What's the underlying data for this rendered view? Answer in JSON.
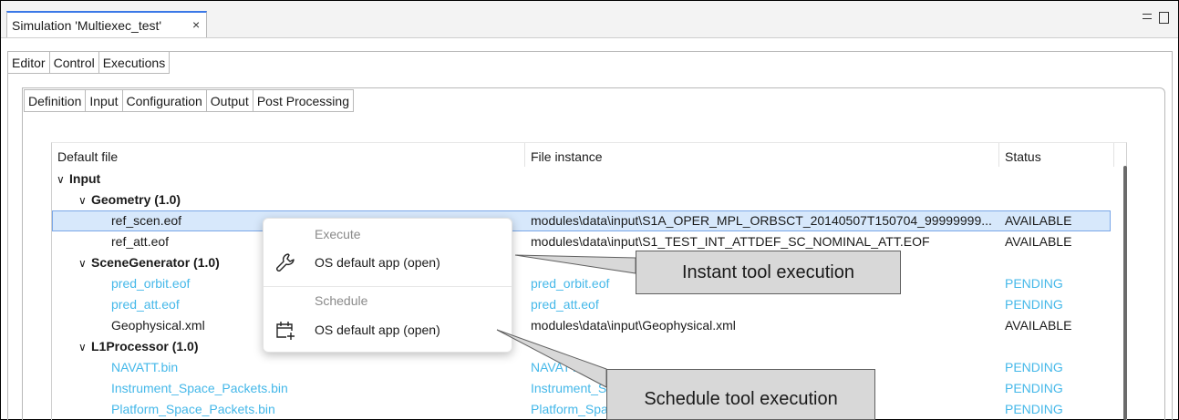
{
  "editor": {
    "tab_title": "Simulation 'Multiexec_test'",
    "close_symbol": "×"
  },
  "top_tabs": [
    "Editor",
    "Control",
    "Executions"
  ],
  "sub_tabs": [
    "Definition",
    "Input",
    "Configuration",
    "Output",
    "Post Processing"
  ],
  "table": {
    "headers": {
      "default_file": "Default file",
      "file_instance": "File instance",
      "status": "Status"
    },
    "rows": [
      {
        "name": "Input",
        "instance": "",
        "status": "",
        "pending": false
      },
      {
        "name": "Geometry (1.0)",
        "instance": "",
        "status": "",
        "pending": false
      },
      {
        "name": "ref_scen.eof",
        "instance": "modules\\data\\input\\S1A_OPER_MPL_ORBSCT_20140507T150704_99999999...",
        "status": "AVAILABLE",
        "pending": false
      },
      {
        "name": "ref_att.eof",
        "instance": "modules\\data\\input\\S1_TEST_INT_ATTDEF_SC_NOMINAL_ATT.EOF",
        "status": "AVAILABLE",
        "pending": false
      },
      {
        "name": "SceneGenerator (1.0)",
        "instance": "",
        "status": "",
        "pending": false
      },
      {
        "name": "pred_orbit.eof",
        "instance": "pred_orbit.eof",
        "status": "PENDING",
        "pending": true
      },
      {
        "name": "pred_att.eof",
        "instance": "pred_att.eof",
        "status": "PENDING",
        "pending": true
      },
      {
        "name": "Geophysical.xml",
        "instance": "modules\\data\\input\\Geophysical.xml",
        "status": "AVAILABLE",
        "pending": false
      },
      {
        "name": "L1Processor (1.0)",
        "instance": "",
        "status": "",
        "pending": false
      },
      {
        "name": "NAVATT.bin",
        "instance": "NAVATT.bin",
        "status": "PENDING",
        "pending": true
      },
      {
        "name": "Instrument_Space_Packets.bin",
        "instance": "Instrument_Space_Packets.bin",
        "status": "PENDING",
        "pending": true
      },
      {
        "name": "Platform_Space_Packets.bin",
        "instance": "Platform_Space_Packets.bin",
        "status": "PENDING",
        "pending": true
      }
    ]
  },
  "context_menu": {
    "execute_header": "Execute",
    "execute_item": "OS default app (open)",
    "execute_icon": "wrench-icon",
    "schedule_header": "Schedule",
    "schedule_item": "OS default app (open)",
    "schedule_icon": "calendar-add-icon"
  },
  "callouts": {
    "instant": "Instant tool execution",
    "schedule": "Schedule tool execution"
  },
  "colors": {
    "pending": "#45b8e9",
    "selection": "#d7e8fb",
    "callout_bg": "#d8d8d8"
  }
}
